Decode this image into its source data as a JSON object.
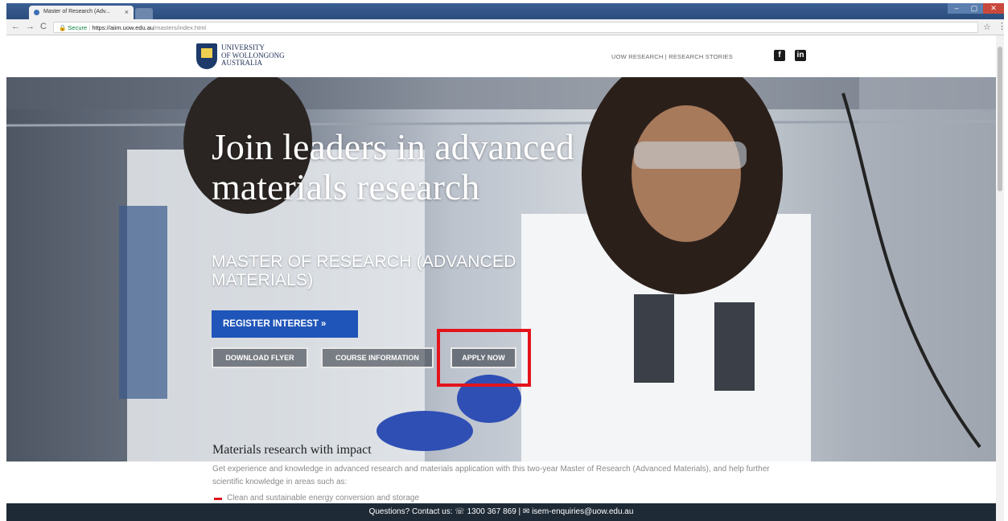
{
  "browser": {
    "tab_title": "Master of Research (Adv...",
    "tab_close": "×",
    "window_controls": {
      "minimize": "–",
      "maximize": "▢",
      "close": "✕"
    },
    "nav": {
      "back": "←",
      "forward": "→",
      "reload": "C"
    },
    "secure_label": "🔒 Secure",
    "url_host": "https://aiim.uow.edu.au",
    "url_path": "/masters/index.html",
    "star": "☆",
    "menu": "⋮"
  },
  "header": {
    "logo_lines": [
      "UNIVERSITY",
      "OF WOLLONGONG",
      "AUSTRALIA"
    ],
    "top_links": "UOW RESEARCH | RESEARCH STORIES",
    "social": {
      "facebook": "f",
      "linkedin": "in"
    }
  },
  "hero": {
    "title": "Join leaders in advanced materials research",
    "subtitle": "MASTER OF RESEARCH (ADVANCED MATERIALS)",
    "register_button": "REGISTER INTEREST »",
    "buttons": {
      "download_flyer": "DOWNLOAD FLYER",
      "course_information": "COURSE INFORMATION",
      "apply_now": "APPLY NOW"
    },
    "highlight_color": "#e3141c"
  },
  "content": {
    "section_title": "Materials research with impact",
    "section_body": "Get experience and knowledge in advanced research and materials application with this two-year Master of Research (Advanced Materials), and help further scientific knowledge in areas such as:",
    "bullets": [
      "Clean and sustainable energy conversion and storage"
    ]
  },
  "footer": {
    "text": "Questions? Contact us: ☏ 1300 367 869  |  ✉ isem-enquiries@uow.edu.au"
  },
  "colors": {
    "accent_blue": "#1f55b8",
    "footer_bg": "#1e2a36",
    "brand_navy": "#1d3a6b"
  }
}
